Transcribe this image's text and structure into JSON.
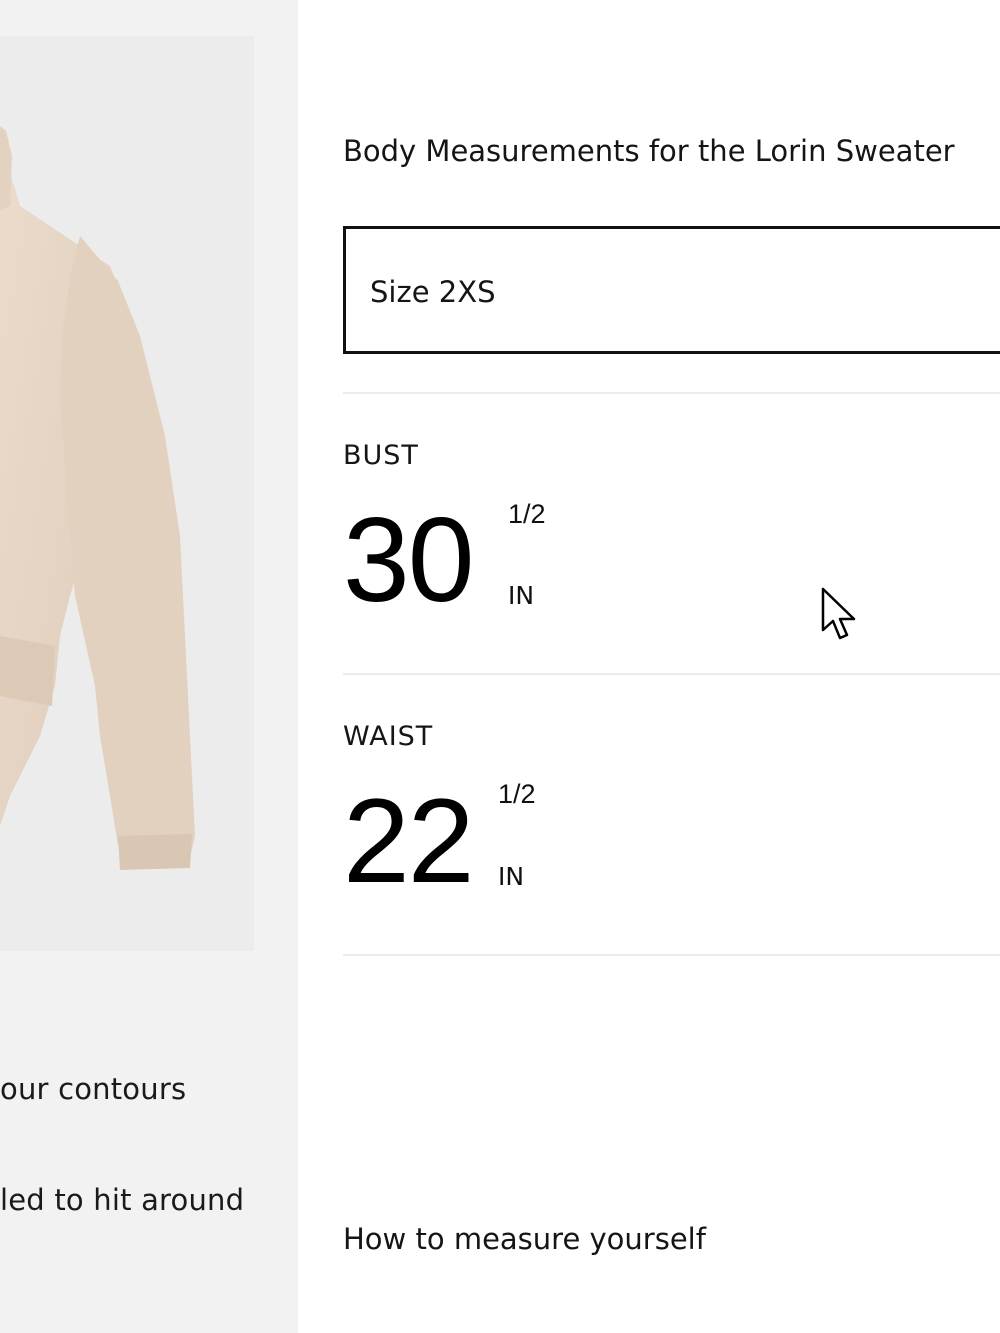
{
  "left": {
    "product_image_alt": "sweater-image",
    "text_line_1": "our contours",
    "text_line_2": "led to hit around"
  },
  "heading": "Body Measurements for the Lorin Sweater",
  "size_select": {
    "label": "Size 2XS"
  },
  "measurements": {
    "bust": {
      "label": "BUST",
      "value": "30",
      "fraction": "1/2",
      "unit": "IN"
    },
    "waist": {
      "label": "WAIST",
      "value": "22",
      "fraction": "1/2",
      "unit": "IN"
    }
  },
  "measure_link": "How to measure yourself",
  "colors": {
    "left_panel_bg": "#f2f2f2",
    "image_bg": "#ececec",
    "sweater": "#e6d5c4",
    "border": "#111111"
  }
}
